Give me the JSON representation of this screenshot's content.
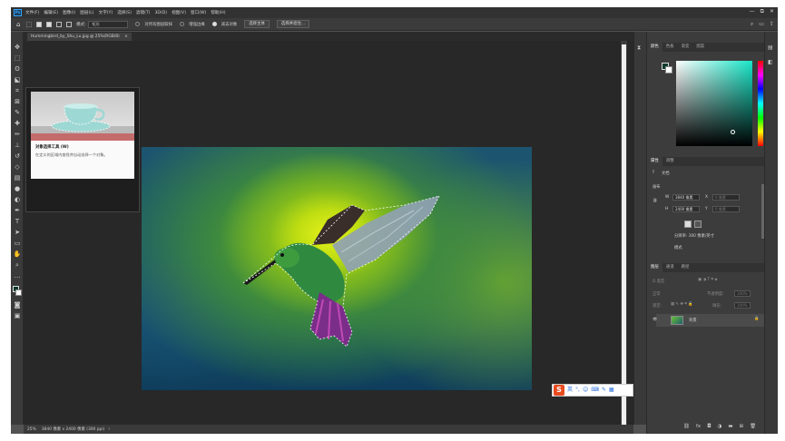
{
  "app": {
    "logo": "Ps",
    "menu": [
      "文件(F)",
      "编辑(E)",
      "图像(I)",
      "图层(L)",
      "文字(Y)",
      "选择(S)",
      "滤镜(T)",
      "3D(D)",
      "视图(V)",
      "窗口(W)",
      "帮助(H)"
    ],
    "window_controls": [
      "—",
      "⧉",
      "✕"
    ]
  },
  "options_bar": {
    "mode_label": "模式:",
    "mode_value": "矩形",
    "sample_all_layers": "对所有图层取样",
    "enhance_edge": "增强边缘",
    "subtract_target": "减去对象",
    "select_subject": "选择主体",
    "select_and_mask": "选择并遮住..."
  },
  "document": {
    "tab_title": "Hummingbird_by_Shu_Lu.jpg @ 25%(RGB/8)",
    "tab_close": "×"
  },
  "tooltip": {
    "title": "对象选择工具 (W)",
    "description": "在定义的区域内查找并自动选择一个对象。"
  },
  "status": {
    "zoom": "25%",
    "doc_info": "3840 像素 x 2400 像素 (300 ppi)",
    "arrow": "›"
  },
  "ime": {
    "logo": "S",
    "items": [
      "英",
      "°,",
      "☺",
      "⌨",
      "✎",
      "▦"
    ]
  },
  "panels": {
    "color_tabs": [
      "颜色",
      "色板",
      "渐变",
      "图案"
    ],
    "properties_tabs": [
      "属性",
      "调整"
    ],
    "properties_doc": "文档",
    "canvas_section": "画布",
    "width_label": "W",
    "width_value": "3840 像素",
    "x_label": "X",
    "x_value": "0 像素",
    "height_label": "H",
    "height_value": "2400 像素",
    "y_label": "Y",
    "y_value": "0 像素",
    "resolution": "分辨率: 300 像素/英寸",
    "mode": "模式",
    "layers_tabs": [
      "图层",
      "通道",
      "路径"
    ],
    "layers_filter": "Q 类型",
    "blend_mode": "正常",
    "opacity_label": "不透明度:",
    "opacity_value": "100%",
    "lock_label": "锁定:",
    "fill_label": "填充:",
    "fill_value": "100%",
    "layer_name": "背景"
  },
  "colors": {
    "accent": "#31a8ff",
    "panel_bg": "#3c3c3c",
    "canvas_bg": "#282828",
    "foreground_swatch": "#0b3a2a",
    "ime_logo": "#e84b1e"
  }
}
